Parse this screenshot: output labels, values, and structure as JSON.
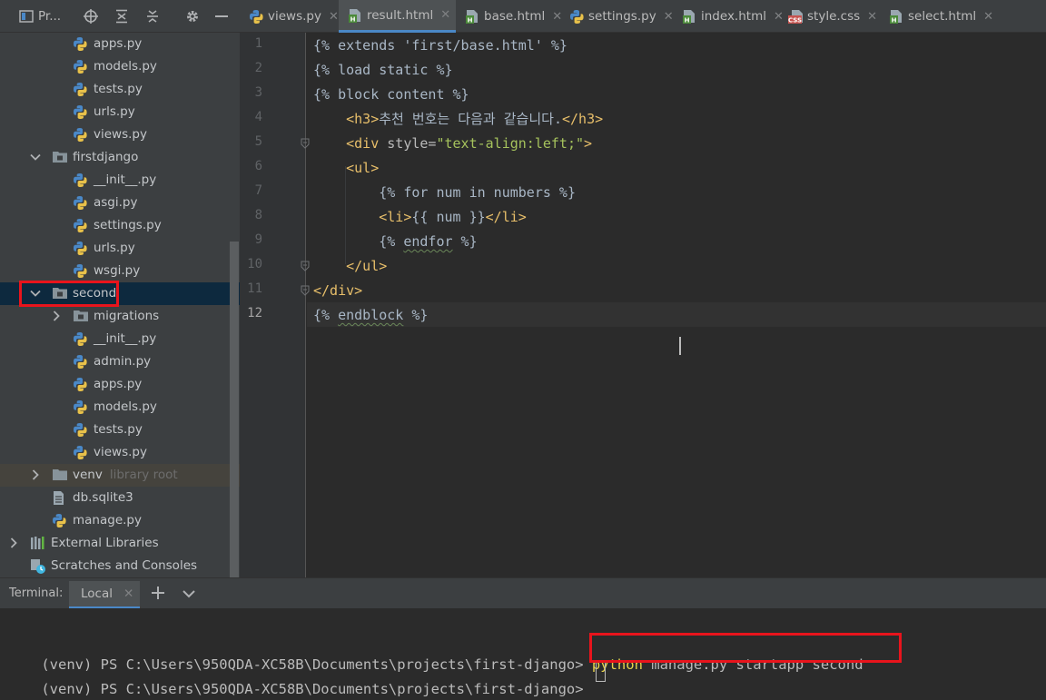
{
  "project_panel": {
    "title": "Pr...",
    "tree": [
      {
        "label": "apps.py",
        "kind": "py"
      },
      {
        "label": "models.py",
        "kind": "py"
      },
      {
        "label": "tests.py",
        "kind": "py"
      },
      {
        "label": "urls.py",
        "kind": "py"
      },
      {
        "label": "views.py",
        "kind": "py"
      },
      {
        "label": "firstdjango",
        "kind": "folder",
        "expanded": true
      },
      {
        "label": "__init__.py",
        "kind": "py"
      },
      {
        "label": "asgi.py",
        "kind": "py"
      },
      {
        "label": "settings.py",
        "kind": "py"
      },
      {
        "label": "urls.py",
        "kind": "py"
      },
      {
        "label": "wsgi.py",
        "kind": "py"
      },
      {
        "label": "second",
        "kind": "folder",
        "expanded": true,
        "selected": true
      },
      {
        "label": "migrations",
        "kind": "folder",
        "expanded": false
      },
      {
        "label": "__init__.py",
        "kind": "py"
      },
      {
        "label": "admin.py",
        "kind": "py"
      },
      {
        "label": "apps.py",
        "kind": "py"
      },
      {
        "label": "models.py",
        "kind": "py"
      },
      {
        "label": "tests.py",
        "kind": "py"
      },
      {
        "label": "views.py",
        "kind": "py"
      },
      {
        "label": "venv",
        "hint": "library root",
        "kind": "folder-plain",
        "expanded": false
      },
      {
        "label": "db.sqlite3",
        "kind": "file"
      },
      {
        "label": "manage.py",
        "kind": "py"
      },
      {
        "label": "External Libraries",
        "kind": "libs",
        "expanded": false
      },
      {
        "label": "Scratches and Consoles",
        "kind": "scratch"
      }
    ]
  },
  "tabs": [
    {
      "label": "views.py",
      "icon": "python-file-icon",
      "active": false
    },
    {
      "label": "result.html",
      "icon": "html-file-icon",
      "active": true
    },
    {
      "label": "base.html",
      "icon": "html-file-icon",
      "active": false
    },
    {
      "label": "settings.py",
      "icon": "python-file-icon",
      "active": false
    },
    {
      "label": "index.html",
      "icon": "html-file-icon",
      "active": false
    },
    {
      "label": "style.css",
      "icon": "css-file-icon",
      "active": false
    },
    {
      "label": "select.html",
      "icon": "html-file-icon",
      "active": false
    }
  ],
  "editor": {
    "line_numbers": [
      "1",
      "2",
      "3",
      "4",
      "5",
      "6",
      "7",
      "8",
      "9",
      "10",
      "11",
      "12"
    ],
    "current_line": 12,
    "lines": [
      [
        {
          "t": "{% extends 'first/base.html' %}",
          "c": ""
        }
      ],
      [
        {
          "t": "{% load static %}",
          "c": ""
        }
      ],
      [
        {
          "t": "{% block content %}",
          "c": ""
        }
      ],
      [
        {
          "t": "    ",
          "c": ""
        },
        {
          "t": "<h3>",
          "c": "tag"
        },
        {
          "t": "추천 번호는 다음과 같습니다.",
          "c": ""
        },
        {
          "t": "</h3>",
          "c": "tag"
        }
      ],
      [
        {
          "t": "    ",
          "c": ""
        },
        {
          "t": "<div ",
          "c": "tag"
        },
        {
          "t": "style=",
          "c": "attr"
        },
        {
          "t": "\"text-align:left;\"",
          "c": "str"
        },
        {
          "t": ">",
          "c": "tag"
        }
      ],
      [
        {
          "t": "    ",
          "c": ""
        },
        {
          "t": "<ul>",
          "c": "tag"
        }
      ],
      [
        {
          "t": "        {% for num in numbers %}",
          "c": ""
        }
      ],
      [
        {
          "t": "        ",
          "c": ""
        },
        {
          "t": "<li>",
          "c": "tag"
        },
        {
          "t": "{{ num }}",
          "c": ""
        },
        {
          "t": "</li>",
          "c": "tag"
        }
      ],
      [
        {
          "t": "        {% ",
          "c": ""
        },
        {
          "t": "endfor",
          "c": "sq"
        },
        {
          "t": " %}",
          "c": ""
        }
      ],
      [
        {
          "t": "    ",
          "c": ""
        },
        {
          "t": "</ul>",
          "c": "tag"
        }
      ],
      [
        {
          "t": "</div>",
          "c": "tag"
        }
      ],
      [
        {
          "t": "{% ",
          "c": ""
        },
        {
          "t": "endblock",
          "c": "sq"
        },
        {
          "t": " %}",
          "c": ""
        }
      ]
    ]
  },
  "terminal": {
    "title": "Terminal:",
    "tab_label": "Local",
    "lines": [
      {
        "prompt": "(venv) PS C:\\Users\\950QDA-XC58B\\Documents\\projects\\first-django> ",
        "cmd": "python",
        "rest": " manage.py startapp second"
      },
      {
        "prompt": "(venv) PS C:\\Users\\950QDA-XC58B\\Documents\\projects\\first-django> ",
        "cmd": "",
        "rest": ""
      }
    ]
  },
  "colors": {
    "highlight_box": "#e8141c",
    "accent": "#4a88c7",
    "tag": "#e8bf6a",
    "string": "#a5c25c"
  }
}
